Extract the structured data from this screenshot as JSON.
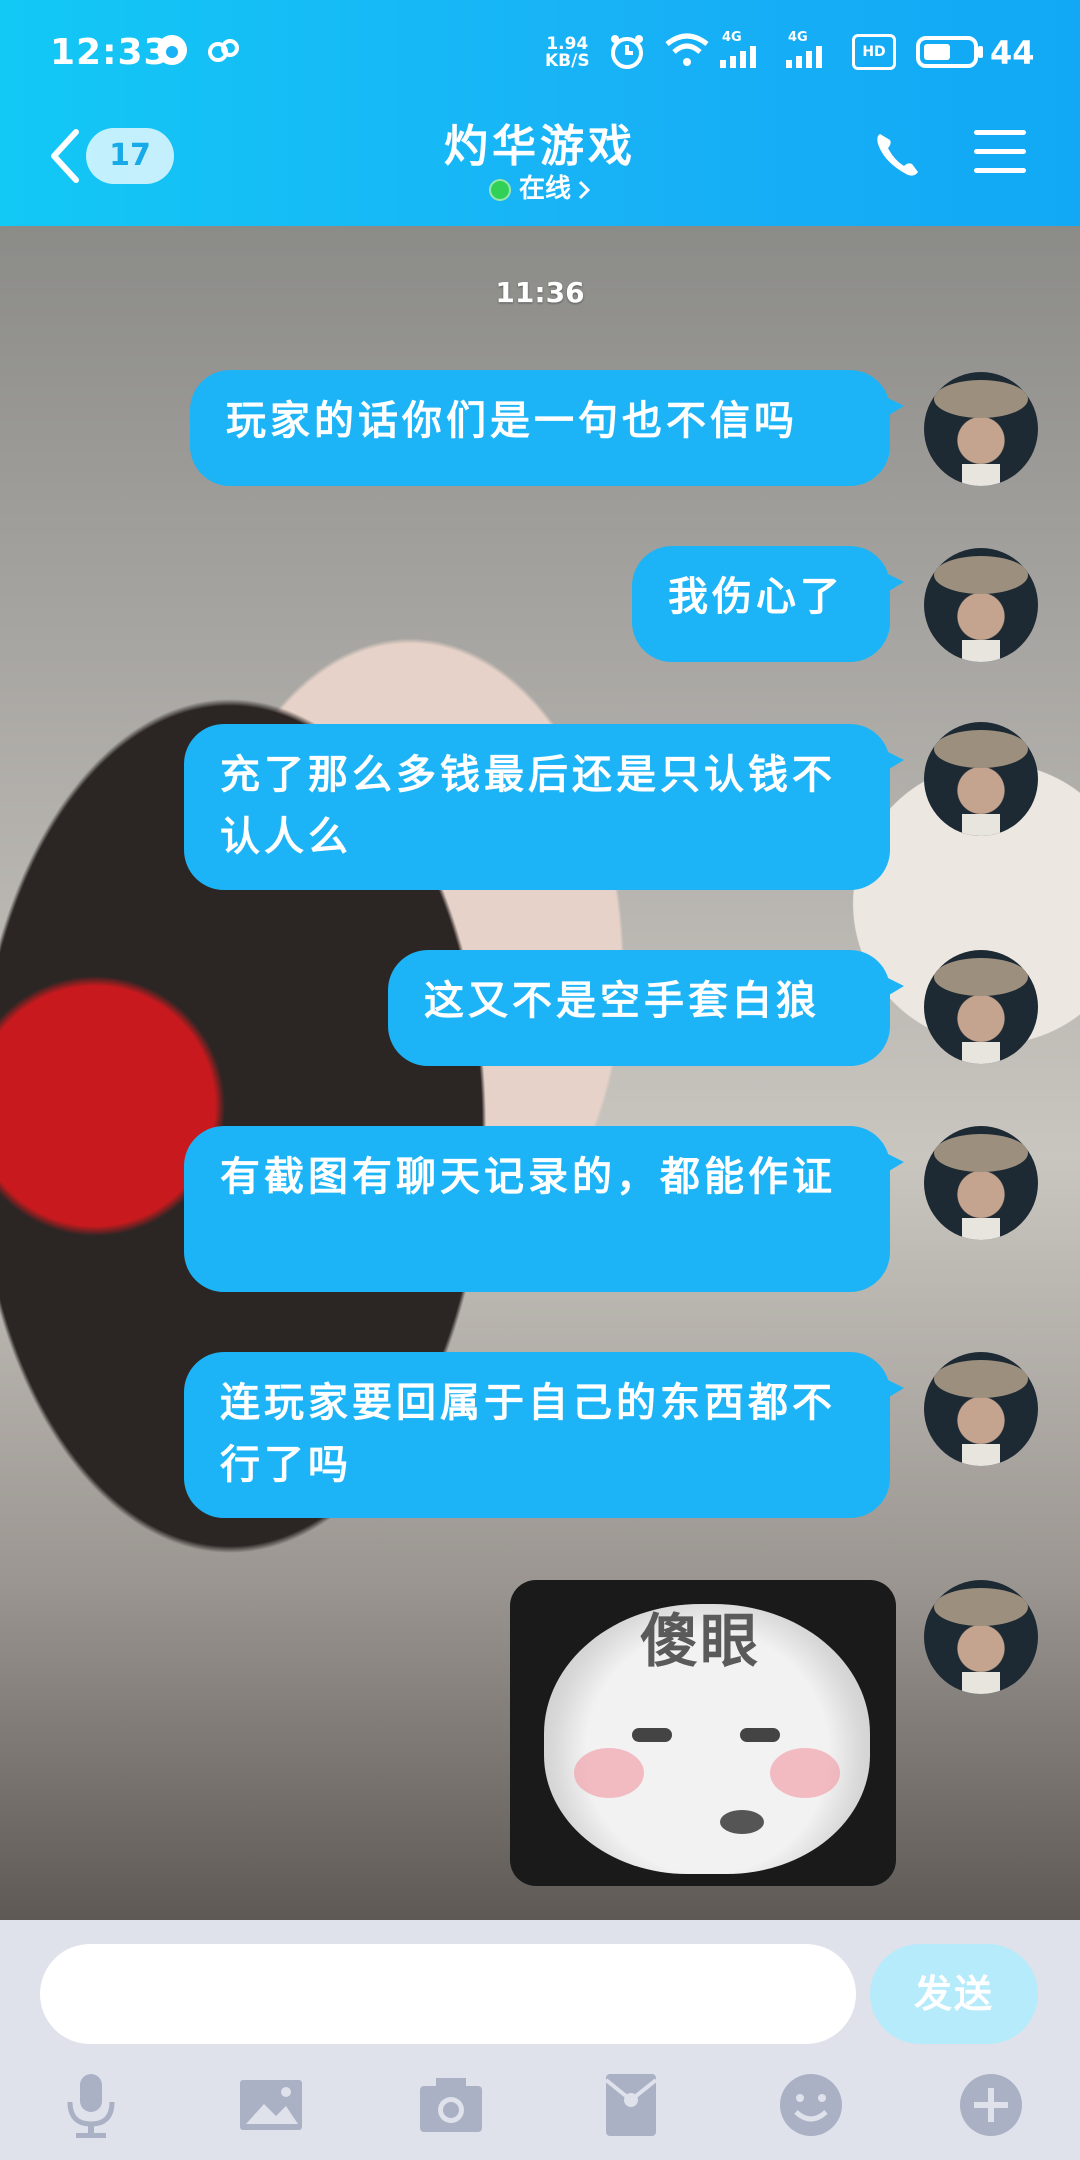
{
  "status_bar": {
    "time": "12:33",
    "speed_value": "1.94",
    "speed_unit": "KB/S",
    "net1": "4G",
    "net2": "4G",
    "hd": "HD",
    "battery": "44"
  },
  "header": {
    "back_badge": "17",
    "title": "灼华游戏",
    "status": "在线"
  },
  "chat": {
    "timestamp": "11:36",
    "messages": [
      {
        "text": "玩家的话你们是一句也不信吗"
      },
      {
        "text": "我伤心了"
      },
      {
        "text": "充了那么多钱最后还是只认钱不认人么"
      },
      {
        "text": "这又不是空手套白狼"
      },
      {
        "text": "有截图有聊天记录的，都能作证"
      },
      {
        "text": "连玩家要回属于自己的东西都不行了吗"
      }
    ],
    "sticker_text": "傻眼"
  },
  "input": {
    "placeholder": "",
    "send_label": "发送"
  },
  "colors": {
    "header": "#18b2f6",
    "bubble": "#1cb4f7",
    "online": "#31d158"
  }
}
